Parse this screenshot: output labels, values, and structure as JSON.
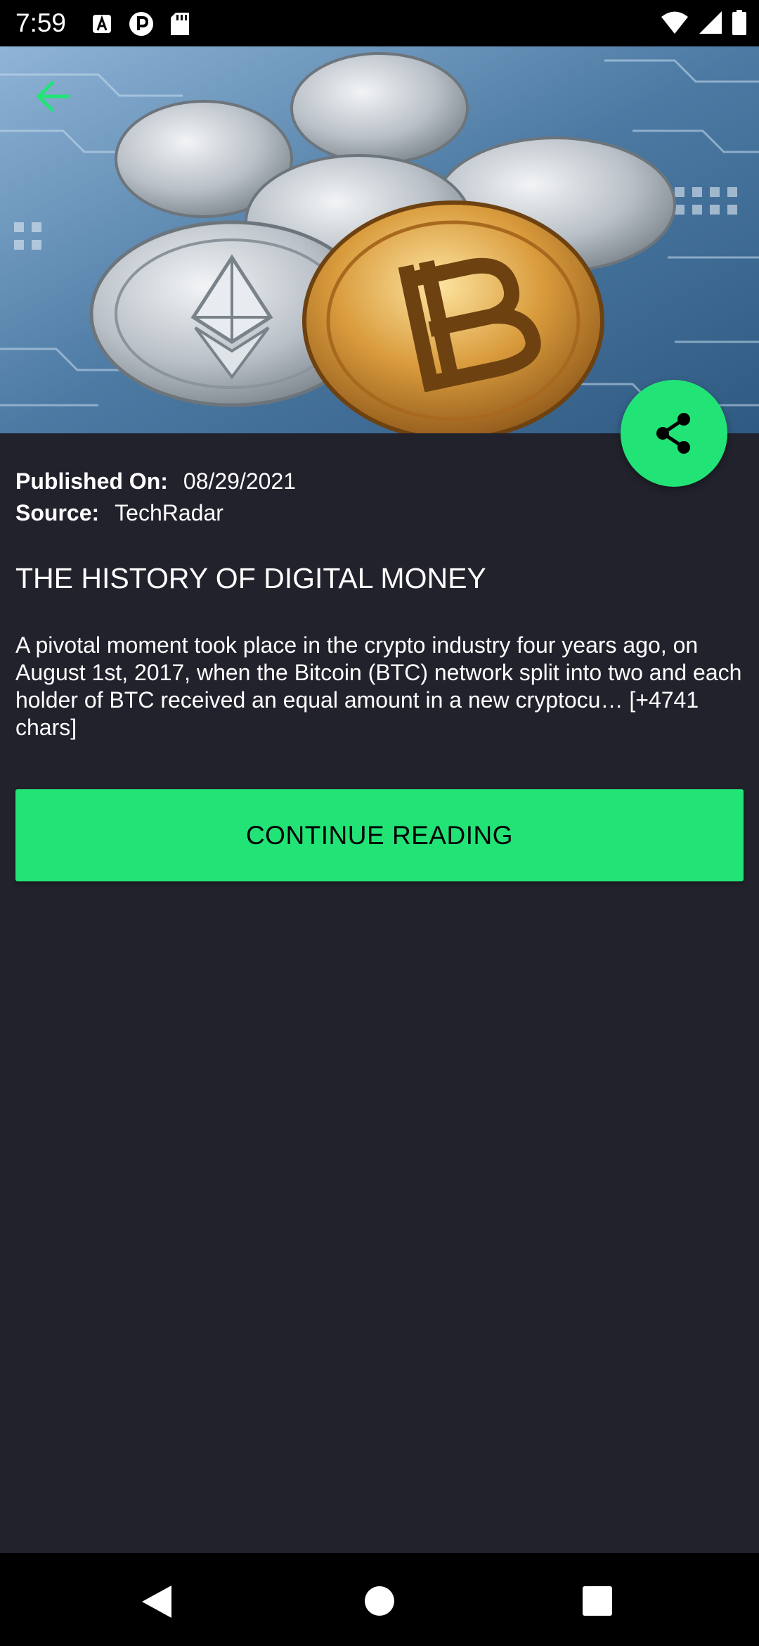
{
  "status_bar": {
    "time": "7:59",
    "left_icons": [
      "a-notification-icon",
      "p-notification-icon",
      "sd-card-icon"
    ],
    "right_icons": [
      "wifi-icon",
      "signal-icon",
      "battery-icon"
    ]
  },
  "hero": {
    "image_subject": "cryptocurrency coins on circuit board",
    "accent_color": "#22e476"
  },
  "meta": {
    "published_label": "Published On:",
    "published_value": "08/29/2021",
    "source_label": "Source:",
    "source_value": "TechRadar"
  },
  "article": {
    "title": "THE HISTORY OF DIGITAL MONEY",
    "description": "A pivotal moment took place in the crypto industry four years ago, on August 1st, 2017, when the Bitcoin (BTC) network split into two and each holder of BTC received an equal amount in a new cryptocu… [+4741 chars]"
  },
  "actions": {
    "continue_label": "CONTINUE READING",
    "share_icon": "share-icon",
    "back_icon": "arrow-back-icon"
  },
  "nav_bar": {
    "icons": [
      "nav-back-icon",
      "nav-home-icon",
      "nav-recents-icon"
    ]
  }
}
